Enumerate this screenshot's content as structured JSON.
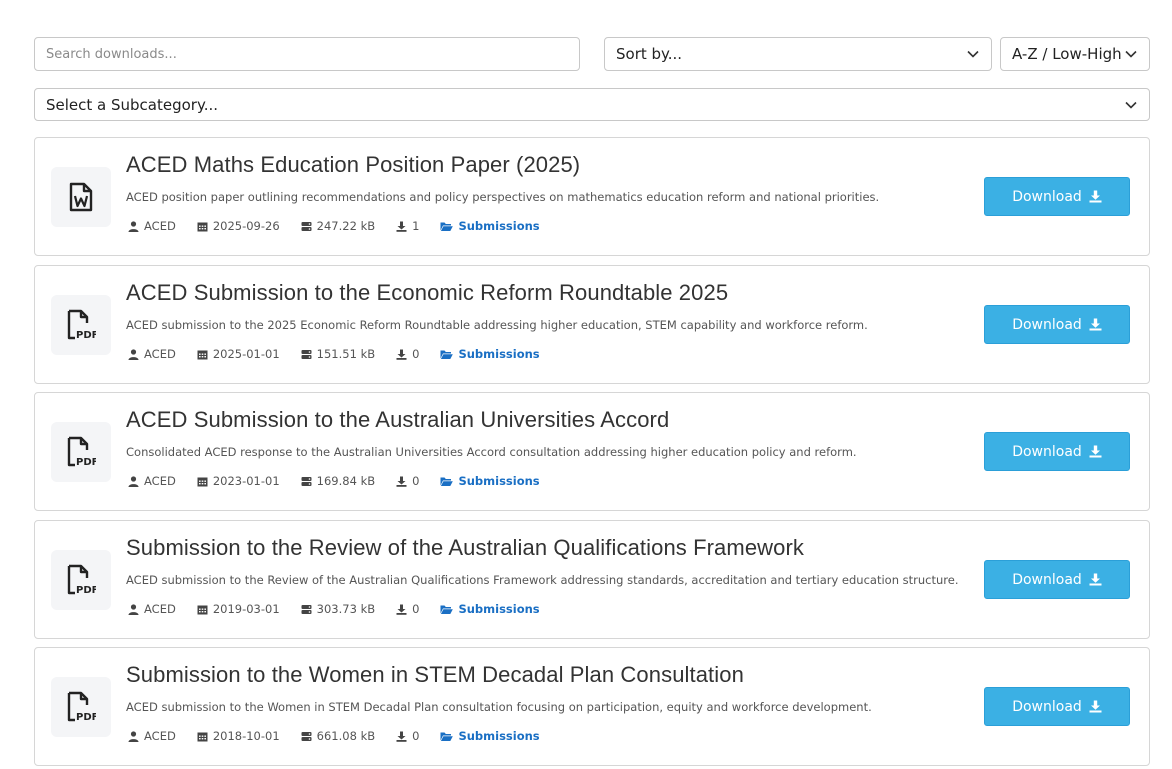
{
  "filters": {
    "search_placeholder": "Search downloads...",
    "sort_label": "Sort by...",
    "order_label": "A-Z / Low-High",
    "subcategory_label": "Select a Subcategory..."
  },
  "colors": {
    "button": "#3bb0e4",
    "link": "#1a6fc4"
  },
  "downloads": [
    {
      "title": "ACED Maths Education Position Paper (2025)",
      "description": "ACED position paper outlining recommendations and policy perspectives on mathematics education reform and national priorities.",
      "author": "ACED",
      "date": "2025-09-26",
      "size": "247.22 kB",
      "count": "1",
      "category": "Submissions",
      "file_icon": "word-file-icon",
      "button_label": "Download"
    },
    {
      "title": "ACED Submission to the Economic Reform Roundtable 2025",
      "description": "ACED submission to the 2025 Economic Reform Roundtable addressing higher education, STEM capability and workforce reform.",
      "author": "ACED",
      "date": "2025-01-01",
      "size": "151.51 kB",
      "count": "0",
      "category": "Submissions",
      "file_icon": "pdf-file-icon",
      "button_label": "Download"
    },
    {
      "title": "ACED Submission to the Australian Universities Accord",
      "description": "Consolidated ACED response to the Australian Universities Accord consultation addressing higher education policy and reform.",
      "author": "ACED",
      "date": "2023-01-01",
      "size": "169.84 kB",
      "count": "0",
      "category": "Submissions",
      "file_icon": "pdf-file-icon",
      "button_label": "Download"
    },
    {
      "title": "Submission to the Review of the Australian Qualifications Framework",
      "description": "ACED submission to the Review of the Australian Qualifications Framework addressing standards, accreditation and tertiary education structure.",
      "author": "ACED",
      "date": "2019-03-01",
      "size": "303.73 kB",
      "count": "0",
      "category": "Submissions",
      "file_icon": "pdf-file-icon",
      "button_label": "Download"
    },
    {
      "title": "Submission to the Women in STEM Decadal Plan Consultation",
      "description": "ACED submission to the Women in STEM Decadal Plan consultation focusing on participation, equity and workforce development.",
      "author": "ACED",
      "date": "2018-10-01",
      "size": "661.08 kB",
      "count": "0",
      "category": "Submissions",
      "file_icon": "pdf-file-icon",
      "button_label": "Download"
    }
  ]
}
